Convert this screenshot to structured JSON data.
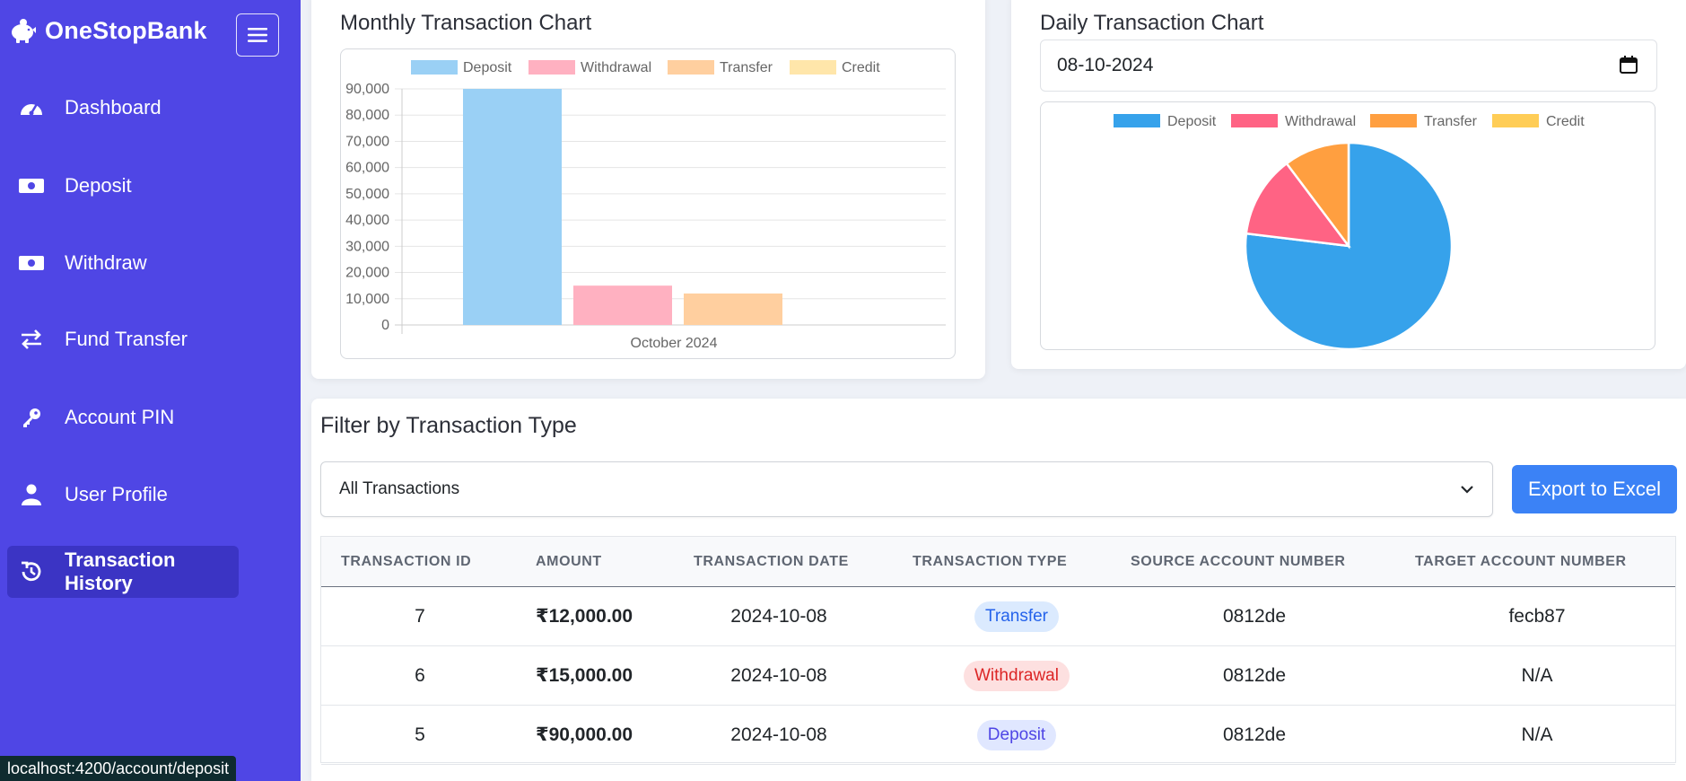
{
  "sidebar": {
    "brand": "OneStopBank",
    "items": [
      {
        "label": "Dashboard",
        "icon": "gauge-icon",
        "active": false
      },
      {
        "label": "Deposit",
        "icon": "money-icon",
        "active": false
      },
      {
        "label": "Withdraw",
        "icon": "money-icon",
        "active": false
      },
      {
        "label": "Fund Transfer",
        "icon": "exchange-icon",
        "active": false
      },
      {
        "label": "Account PIN",
        "icon": "key-icon",
        "active": false
      },
      {
        "label": "User Profile",
        "icon": "user-icon",
        "active": false
      },
      {
        "label": "Transaction History",
        "icon": "history-icon",
        "active": true
      }
    ]
  },
  "monthly_chart": {
    "title": "Monthly Transaction Chart",
    "legend": [
      "Deposit",
      "Withdrawal",
      "Transfer",
      "Credit"
    ],
    "x_label": "October 2024"
  },
  "daily_chart": {
    "title": "Daily Transaction Chart",
    "date": "08-10-2024",
    "legend": [
      "Deposit",
      "Withdrawal",
      "Transfer",
      "Credit"
    ]
  },
  "chart_data": [
    {
      "type": "bar",
      "title": "Monthly Transaction Chart",
      "categories": [
        "October 2024"
      ],
      "series": [
        {
          "name": "Deposit",
          "values": [
            90000
          ],
          "color": "#9ad0f5"
        },
        {
          "name": "Withdrawal",
          "values": [
            15000
          ],
          "color": "#ffb1c1"
        },
        {
          "name": "Transfer",
          "values": [
            12000
          ],
          "color": "#ffcf9f"
        },
        {
          "name": "Credit",
          "values": [
            0
          ],
          "color": "#ffe6aa"
        }
      ],
      "ylim": [
        0,
        90000
      ],
      "yticks": [
        "90,000",
        "80,000",
        "70,000",
        "60,000",
        "50,000",
        "40,000",
        "30,000",
        "20,000",
        "10,000",
        "0"
      ],
      "legend": "top"
    },
    {
      "type": "pie",
      "title": "Daily Transaction Chart",
      "categories": [
        "Deposit",
        "Withdrawal",
        "Transfer",
        "Credit"
      ],
      "values": [
        90000,
        15000,
        12000,
        0
      ],
      "colors": [
        "#36a2eb",
        "#ff6384",
        "#ff9f40",
        "#ffcd56"
      ],
      "legend": "top"
    }
  ],
  "filter": {
    "title": "Filter by Transaction Type",
    "selected": "All Transactions",
    "export_label": "Export to Excel"
  },
  "table": {
    "headers": [
      "TRANSACTION ID",
      "AMOUNT",
      "TRANSACTION DATE",
      "TRANSACTION TYPE",
      "SOURCE ACCOUNT NUMBER",
      "TARGET ACCOUNT NUMBER"
    ],
    "rows": [
      {
        "id": "7",
        "amount": "₹12,000.00",
        "date": "2024-10-08",
        "type": "Transfer",
        "source": "0812de",
        "target": "fecb87"
      },
      {
        "id": "6",
        "amount": "₹15,000.00",
        "date": "2024-10-08",
        "type": "Withdrawal",
        "source": "0812de",
        "target": "N/A"
      },
      {
        "id": "5",
        "amount": "₹90,000.00",
        "date": "2024-10-08",
        "type": "Deposit",
        "source": "0812de",
        "target": "N/A"
      }
    ]
  },
  "badge_colors": {
    "Transfer": {
      "bg": "#dbeafe",
      "fg": "#2563eb"
    },
    "Withdrawal": {
      "bg": "#fde0e0",
      "fg": "#dc2626"
    },
    "Deposit": {
      "bg": "#e0e7ff",
      "fg": "#4f46e5"
    }
  },
  "status_bar": {
    "url": "localhost:4200/account/deposit"
  }
}
